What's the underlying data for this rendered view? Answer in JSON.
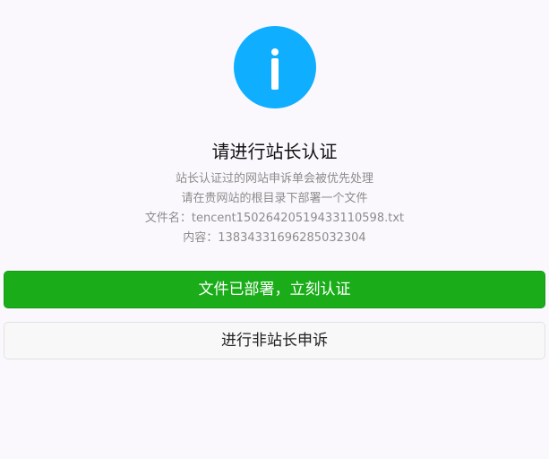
{
  "icon": {
    "name": "info-icon",
    "color": "#10aeff"
  },
  "title": "请进行站长认证",
  "description": {
    "line1": "站长认证过的网站申诉单会被优先处理",
    "line2": "请在贵网站的根目录下部署一个文件",
    "line3": "文件名：tencent15026420519433110598.txt",
    "line4": "内容：13834331696285032304"
  },
  "buttons": {
    "primary_label": "文件已部署，立刻认证",
    "secondary_label": "进行非站长申诉"
  },
  "colors": {
    "background": "#fbf8fd",
    "primary_button": "#1aad19",
    "secondary_button": "#f8f8f8",
    "muted_text": "#8c8c8c"
  }
}
